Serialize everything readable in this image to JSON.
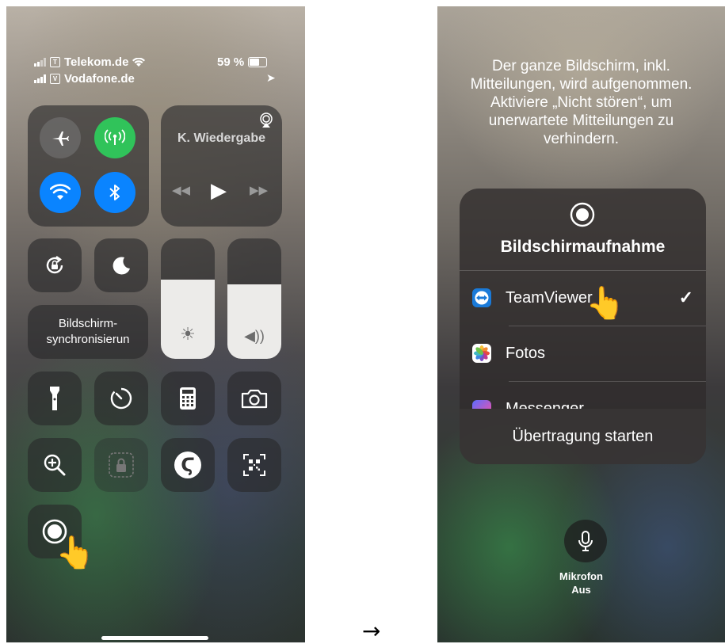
{
  "left": {
    "status": {
      "carrier1": "Telekom.de",
      "carrier1_sim": "T",
      "carrier2": "Vodafone.de",
      "carrier2_sim": "V",
      "battery": "59 %"
    },
    "media": {
      "label": "K. Wiedergabe"
    },
    "screen_mirroring": {
      "label": "Bildschirm-\nsynchronisierun"
    },
    "levels": {
      "brightness": 0.66,
      "volume": 0.62
    }
  },
  "right": {
    "message": "Der ganze Bildschirm, inkl. Mitteilungen, wird aufgenommen. Aktiviere „Nicht stören“, um unerwartete Mitteilungen zu verhindern.",
    "popup": {
      "title": "Bildschirmaufnahme",
      "items": [
        {
          "label": "TeamViewer",
          "selected": true
        },
        {
          "label": "Fotos",
          "selected": false
        },
        {
          "label": "Messenger",
          "selected": false
        }
      ],
      "start_button": "Übertragung starten"
    },
    "mic": {
      "label": "Mikrofon",
      "state": "Aus"
    }
  },
  "arrow": "→",
  "colors": {
    "green": "#30c35a",
    "blue": "#0a84ff",
    "teamviewer": "#1a7ad8"
  },
  "icons": [
    "airplane-icon",
    "antenna-icon",
    "wifi-icon",
    "bluetooth-icon",
    "airplay-icon",
    "rotation-lock-icon",
    "moon-icon",
    "sun-icon",
    "speaker-icon",
    "flashlight-icon",
    "timer-icon",
    "calculator-icon",
    "camera-icon",
    "magnifier-icon",
    "guided-access-icon",
    "shazam-icon",
    "qr-code-icon",
    "record-icon",
    "hand-pointer-icon",
    "checkmark-icon",
    "microphone-icon"
  ]
}
